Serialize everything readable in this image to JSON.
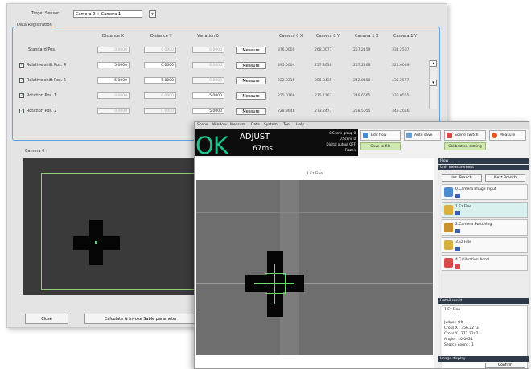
{
  "back_window": {
    "target_sensor_label": "Target Sensor",
    "target_sensor_value": "Camera 0 + Camera 1",
    "group_label": "Data Registration",
    "columns": [
      "Distance X",
      "Distance Y",
      "Variation θ",
      "",
      "Camera 0 X",
      "Camera 0 Y",
      "Camera 1 X",
      "Camera 1 Y"
    ],
    "rows": [
      {
        "label": "Standard Pos.",
        "checked": false,
        "fields": [
          "0.0000",
          "0.0000",
          "0.0000"
        ],
        "button": "Measure",
        "nums": [
          "376.0000",
          "268.0077",
          "257.2159",
          "334.2507"
        ]
      },
      {
        "label": "Relative shift Pos. 4",
        "checked": true,
        "fields": [
          "5.0000",
          "0.0000",
          "0.0000"
        ],
        "button": "Measure",
        "nums": [
          "395.0004",
          "257.8036",
          "257.2268",
          "324.0089"
        ]
      },
      {
        "label": "Relative shift Pos. 5",
        "checked": true,
        "fields": [
          "5.0000",
          "5.0000",
          "0.0000"
        ],
        "button": "Measure",
        "nums": [
          "222.0215",
          "255.8435",
          "242.0150",
          "435.2577"
        ]
      },
      {
        "label": "Rotation Pos. 1",
        "checked": true,
        "fields": [
          "0.0000",
          "0.0000",
          "5.0000"
        ],
        "button": "Measure",
        "nums": [
          "225.0166",
          "275.1163",
          "248.6665",
          "336.0565"
        ]
      },
      {
        "label": "Rotation Pos. 2",
        "checked": true,
        "fields": [
          "0.0000",
          "0.0000",
          "5.0000"
        ],
        "button": "Measure",
        "nums": [
          "228.3646",
          "273.2477",
          "258.5055",
          "345.2056"
        ]
      }
    ],
    "camera_label": "Camera 0 :",
    "close_button": "Close",
    "calc_button": "Calculate & invoke Sable parameter"
  },
  "front_window": {
    "menu": [
      "Scene",
      "Window",
      "Measure",
      "Data",
      "System",
      "Tool",
      "Help"
    ],
    "status": "OK",
    "mode": "ADJUST",
    "time": "67ms",
    "info": [
      "0:Scene group 0",
      "0:Scene 0",
      "Digital output OFF",
      "Frozen"
    ],
    "toolbar": {
      "edit_flow": "Edit flow",
      "auto_save": "Auto save",
      "scene_switch": "Scene switch",
      "measure": "Measure",
      "btn_row2_a": "Save to file",
      "btn_row2_b": "Calibration setting"
    },
    "image_title": "1.Ez Fine",
    "panel": {
      "flow_header": "Flow",
      "unit_header": "Unit measurement",
      "prev_button": "Ins. Branch",
      "next_button": "Next Branch",
      "units": [
        "0.Camera Image Input",
        "1.Ez Fine",
        "2.Camera Switching",
        "3.Ez Fine",
        "4.Calibration Accel"
      ],
      "detail_header": "Detail result",
      "detail_title": "1.Ez Fine",
      "detail_lines": [
        "Judge : OK",
        "Cross X : 356.2273",
        "Cross Y : 272.2242",
        "Angle : 10.0021",
        "Search count : 1"
      ],
      "image_display_header": "Image display",
      "confirm_button": "Confirm"
    }
  }
}
